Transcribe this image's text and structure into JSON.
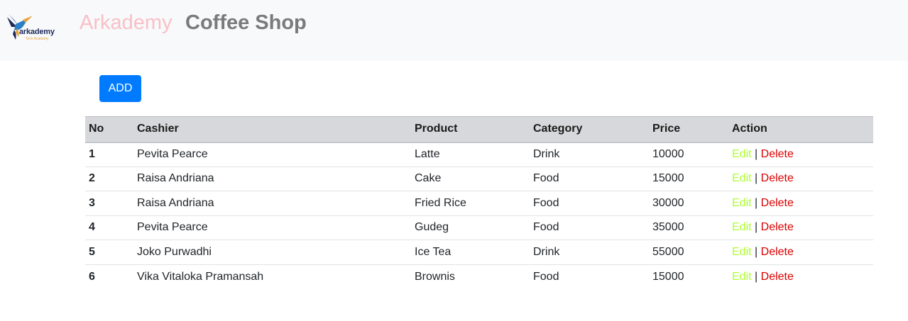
{
  "header": {
    "logo_word": "arkademy",
    "logo_tagline": "Tech Academy",
    "brand_primary": "Arkademy",
    "brand_secondary": "Coffee Shop"
  },
  "toolbar": {
    "add_label": "ADD"
  },
  "table": {
    "columns": {
      "no": "No",
      "cashier": "Cashier",
      "product": "Product",
      "category": "Category",
      "price": "Price",
      "action": "Action"
    },
    "rows": [
      {
        "no": "1",
        "cashier": "Pevita Pearce",
        "product": "Latte",
        "category": "Drink",
        "price": "10000",
        "edit": "Edit",
        "sep": "|",
        "delete": "Delete"
      },
      {
        "no": "2",
        "cashier": "Raisa Andriana",
        "product": "Cake",
        "category": "Food",
        "price": "15000",
        "edit": "Edit",
        "sep": "|",
        "delete": "Delete"
      },
      {
        "no": "3",
        "cashier": "Raisa Andriana",
        "product": "Fried Rice",
        "category": "Food",
        "price": "30000",
        "edit": "Edit",
        "sep": "|",
        "delete": "Delete"
      },
      {
        "no": "4",
        "cashier": "Pevita Pearce",
        "product": "Gudeg",
        "category": "Food",
        "price": "35000",
        "edit": "Edit",
        "sep": "|",
        "delete": "Delete"
      },
      {
        "no": "5",
        "cashier": "Joko Purwadhi",
        "product": "Ice Tea",
        "category": "Drink",
        "price": "55000",
        "edit": "Edit",
        "sep": "|",
        "delete": "Delete"
      },
      {
        "no": "6",
        "cashier": "Vika Vitaloka Pramansah",
        "product": "Brownis",
        "category": "Food",
        "price": "15000",
        "edit": "Edit",
        "sep": "|",
        "delete": "Delete"
      }
    ]
  },
  "colors": {
    "navbar_bg": "#f8f9fa",
    "brand_primary": "#f8c0c8",
    "brand_secondary": "#7a7a7a",
    "add_button": "#007bff",
    "header_row_bg": "#d6d8db",
    "edit_link": "#adff2f",
    "delete_link": "#dc0000"
  },
  "icons": {
    "logo": "hummingbird-logo-icon"
  }
}
